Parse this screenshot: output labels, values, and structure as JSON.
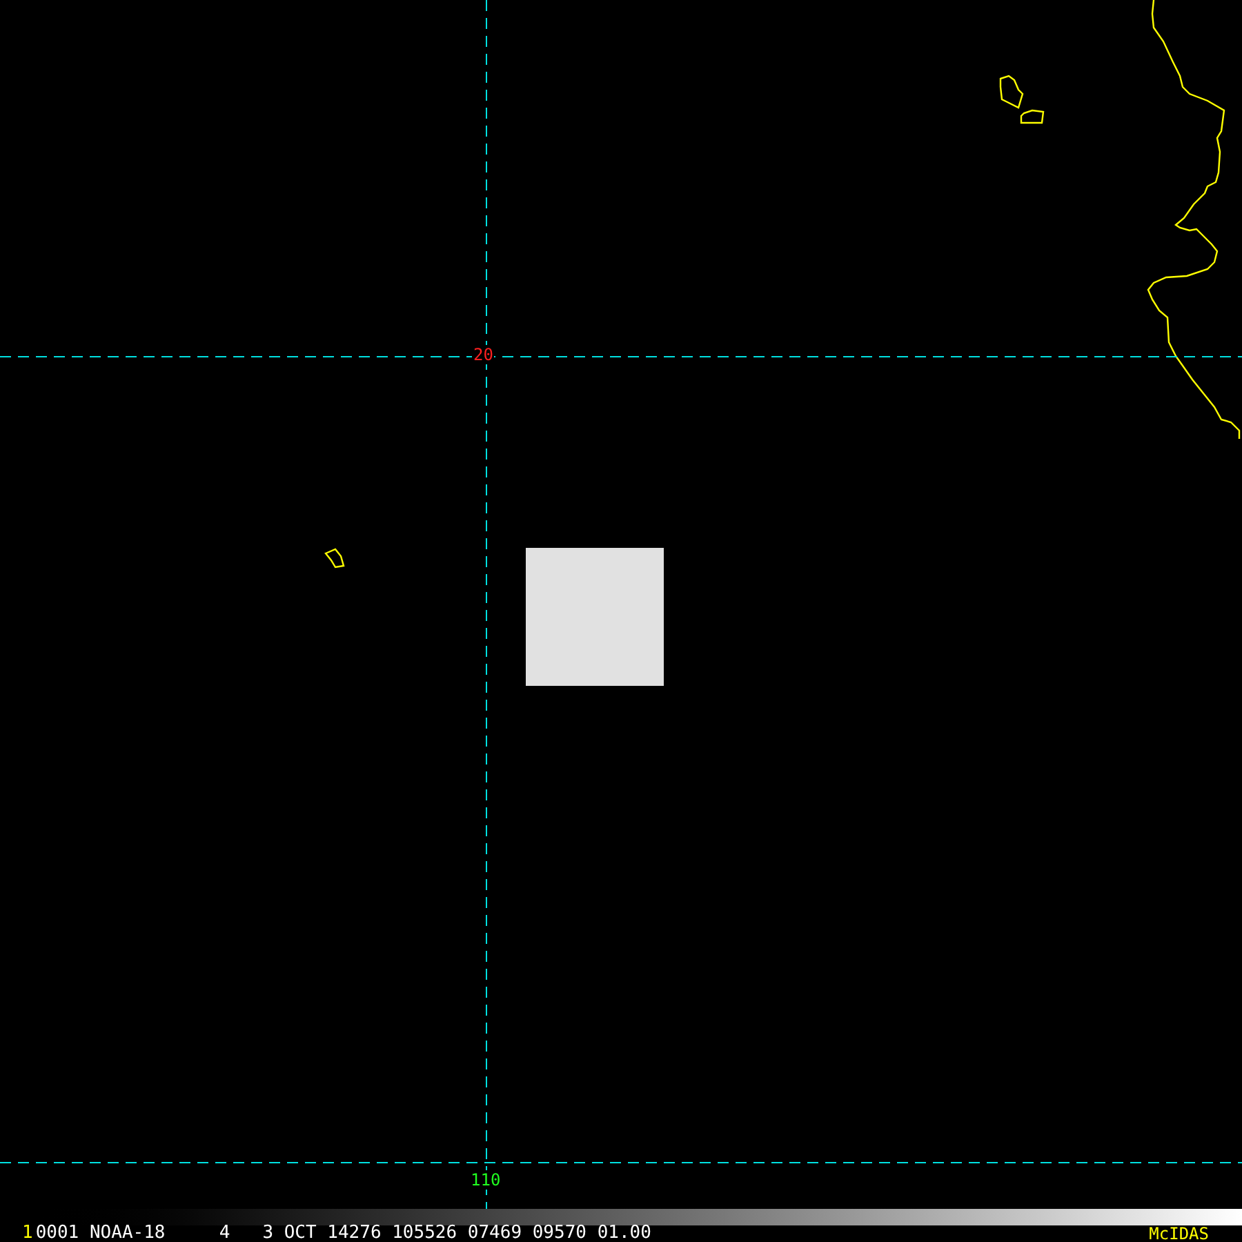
{
  "map": {
    "grid_labels": [
      {
        "kind": "latitude",
        "text": "20"
      },
      {
        "kind": "longitude",
        "text": "110"
      }
    ]
  },
  "status_bar": {
    "frame": "1",
    "info": "0001 NOAA-18     4   3 OCT 14276 105526 07469 09570 01.00",
    "brand": "McIDAS"
  }
}
